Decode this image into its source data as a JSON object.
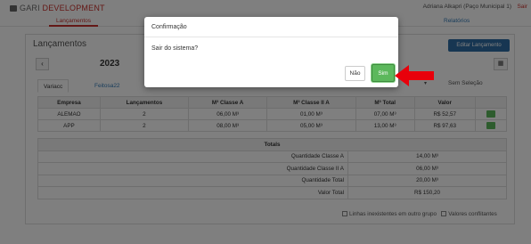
{
  "header": {
    "brand_part1": "GARI",
    "brand_part2": "DEVELOPMENT",
    "user_info": "Adriana Alkapri (Paço Municipal 1)",
    "logout_label": "Sair",
    "tabs": [
      {
        "label": "Lançamentos"
      },
      {
        "label": "Relatórios"
      }
    ]
  },
  "main": {
    "title": "Lançamentos",
    "edit_button": "Editar Lançamento",
    "year": "2023",
    "prev_symbol": "‹",
    "group_tabs": [
      {
        "label": "Variacc"
      },
      {
        "label": "Feitosa22"
      }
    ],
    "no_selection_label": "Sem Seleção",
    "table": {
      "headers": [
        "Empresa",
        "Lançamentos",
        "M³ Classe A",
        "M³ Classe II A",
        "M³ Total",
        "Valor"
      ],
      "rows": [
        {
          "empresa": "ALEMAO",
          "lancamentos": "2",
          "classe_a": "06,00 M³",
          "classe_iia": "01,00 M³",
          "total": "07,00 M³",
          "valor": "R$ 52,57"
        },
        {
          "empresa": "APP",
          "lancamentos": "2",
          "classe_a": "08,00 M³",
          "classe_iia": "05,00 M³",
          "total": "13,00 M³",
          "valor": "R$ 97,63"
        }
      ]
    },
    "totals": {
      "title": "Totals",
      "rows": [
        {
          "label": "Quantidade Classe A",
          "value": "14,00 M³"
        },
        {
          "label": "Quantidade Classe II A",
          "value": "06,00 M³"
        },
        {
          "label": "Quantidade Total",
          "value": "20,00 M³"
        },
        {
          "label": "Valor Total",
          "value": "R$ 150,20"
        }
      ]
    },
    "footer": {
      "option1": "Linhas inexistentes em outro grupo",
      "option2": "Valores conflitantes"
    }
  },
  "dialog": {
    "title": "Confirmação",
    "message": "Sair do sistema?",
    "no_label": "Não",
    "yes_label": "Sim"
  },
  "colors": {
    "brand_accent": "#c9302c",
    "primary": "#2e6da4",
    "success": "#5cb85c",
    "arrow": "#e8000b"
  }
}
